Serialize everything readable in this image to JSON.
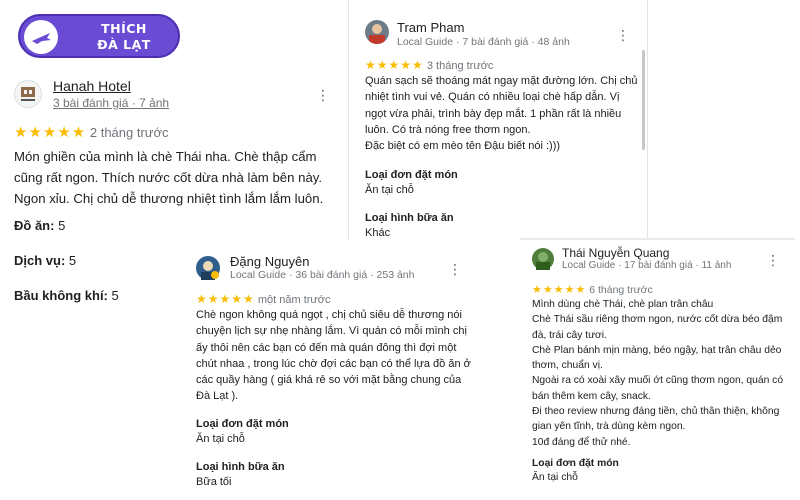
{
  "brand": {
    "line1": "THÍCH",
    "line2": "ĐÀ LẠT"
  },
  "colors": {
    "star": "#fbbc04",
    "logo_bg": "#6a4bd4",
    "text": "#202124",
    "muted": "#70757a"
  },
  "reviews": [
    {
      "name": "Hanah Hotel",
      "meta": "3 bài đánh giá · 7 ảnh",
      "stars": "★★★★★",
      "ago": "2 tháng trước",
      "text": "Món ghiền của mình là chè Thái nha. Chè thập cẩm cũng rất ngon. Thích nước cốt dừa nhà làm bên này. Ngon xỉu. Chị chủ dễ thương nhiệt tình lắm lắm luôn.",
      "attributes": [
        {
          "label": "Đồ ăn:",
          "value": "5"
        },
        {
          "label": "Dịch vụ:",
          "value": "5"
        },
        {
          "label": "Bầu không khí:",
          "value": "5"
        }
      ]
    },
    {
      "name": "Tram Pham",
      "meta": "Local Guide · 7 bài đánh giá · 48 ảnh",
      "stars": "★★★★★",
      "ago": "3 tháng trước",
      "text": "Quán sạch sẽ thoáng mát ngay mặt đường lớn. Chị chủ nhiệt tình vui vẻ. Quán có nhiều loại chè hấp dẫn. Vị ngọt vừa phải, trình bày đẹp mắt. 1 phần rất là nhiều luôn. Có trà nóng free thơm ngon.\nĐặc biệt có em mèo tên Đậu biết nói :)))",
      "fields": [
        {
          "label": "Loại đơn đặt món",
          "value": "Ăn tại chỗ"
        },
        {
          "label": "Loại hình bữa ăn",
          "value": "Khác"
        }
      ]
    },
    {
      "name": "Đặng Nguyên",
      "meta": "Local Guide · 36 bài đánh giá · 253 ảnh",
      "stars": "★★★★★",
      "ago": "một năm trước",
      "text": "Chè ngon không quá ngọt , chị chủ siêu dễ thương nói chuyện lịch sự nhẹ nhàng lắm. Vì quán có mỗi mình chị ấy thôi nên các bạn có đến mà quán đông thì đợi một chút nhaa , trong lúc chờ đợi các bạn có thể lựa đồ ăn ở các quầy hàng ( giá khá rẻ so với mặt bằng chung của Đà Lạt ).",
      "fields": [
        {
          "label": "Loại đơn đặt món",
          "value": "Ăn tại chỗ"
        },
        {
          "label": "Loại hình bữa ăn",
          "value": "Bữa tối"
        }
      ]
    },
    {
      "name": "Thái Nguyễn Quang",
      "meta": "Local Guide · 17 bài đánh giá · 11 ảnh",
      "stars": "★★★★★",
      "ago": "6 tháng trước",
      "text": "Mình dùng chè Thái, chè plan trân châu\nChè Thái sầu riêng thơm ngon, nước cốt dừa béo đậm đà, trái cây tươi.\nChè Plan bánh mịn màng, béo ngậy, hạt trân châu dẻo thơm, chuẩn vị.\nNgoài ra có xoài xây muối ớt cũng thơm ngon, quán có bán thêm kem cây, snack.\nĐi theo review nhưng đáng tiền, chủ thân thiện, không gian yên tĩnh, trà dùng kèm ngon.\n10đ đáng để thử nhé.",
      "fields": [
        {
          "label": "Loại đơn đặt món",
          "value": "Ăn tại chỗ"
        }
      ]
    }
  ]
}
